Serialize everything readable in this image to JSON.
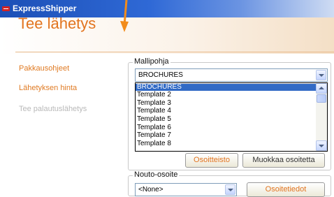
{
  "app": {
    "title": "ExpressShipper"
  },
  "header": {
    "title": "Tee lähetys"
  },
  "sidebar": {
    "items": [
      {
        "label": "Pakkausohjeet",
        "enabled": true
      },
      {
        "label": "Lähetyksen hinta",
        "enabled": true
      },
      {
        "label": "Tee palautuslähetys",
        "enabled": false
      }
    ]
  },
  "template_group": {
    "legend": "Mallipohja",
    "selected": "BROCHURES",
    "options": [
      "BROCHURES",
      "Template 2",
      "Template 3",
      "Template 4",
      "Template 5",
      "Template 6",
      "Template 7",
      "Template 8"
    ],
    "highlighted_index": 0
  },
  "address_buttons": {
    "address_book": "Osoitteisto",
    "edit_address": "Muokkaa osoitetta"
  },
  "pickup_group": {
    "legend": "Nouto-osoite",
    "selected": "<None>",
    "details_button": "Osoitetiedot"
  },
  "colors": {
    "accent": "#e2741f",
    "titlebar": "#2f69d6",
    "selection": "#316ac5"
  }
}
